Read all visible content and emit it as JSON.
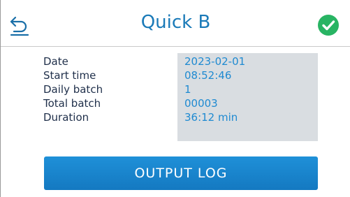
{
  "header": {
    "title": "Quick B",
    "back_icon": "back-arrow-icon",
    "status_icon": "check-circle-icon",
    "status_color": "#28b463",
    "accent_color": "#1a7ab8"
  },
  "info": {
    "rows": [
      {
        "label": "Date",
        "value": "2023-02-01"
      },
      {
        "label": "Start time",
        "value": "08:52:46"
      },
      {
        "label": "Daily batch",
        "value": "1"
      },
      {
        "label": "Total batch",
        "value": "00003"
      },
      {
        "label": "Duration",
        "value": "36:12 min"
      }
    ]
  },
  "actions": {
    "output_log_label": "OUTPUT LOG",
    "button_color": "#1a86cc"
  }
}
